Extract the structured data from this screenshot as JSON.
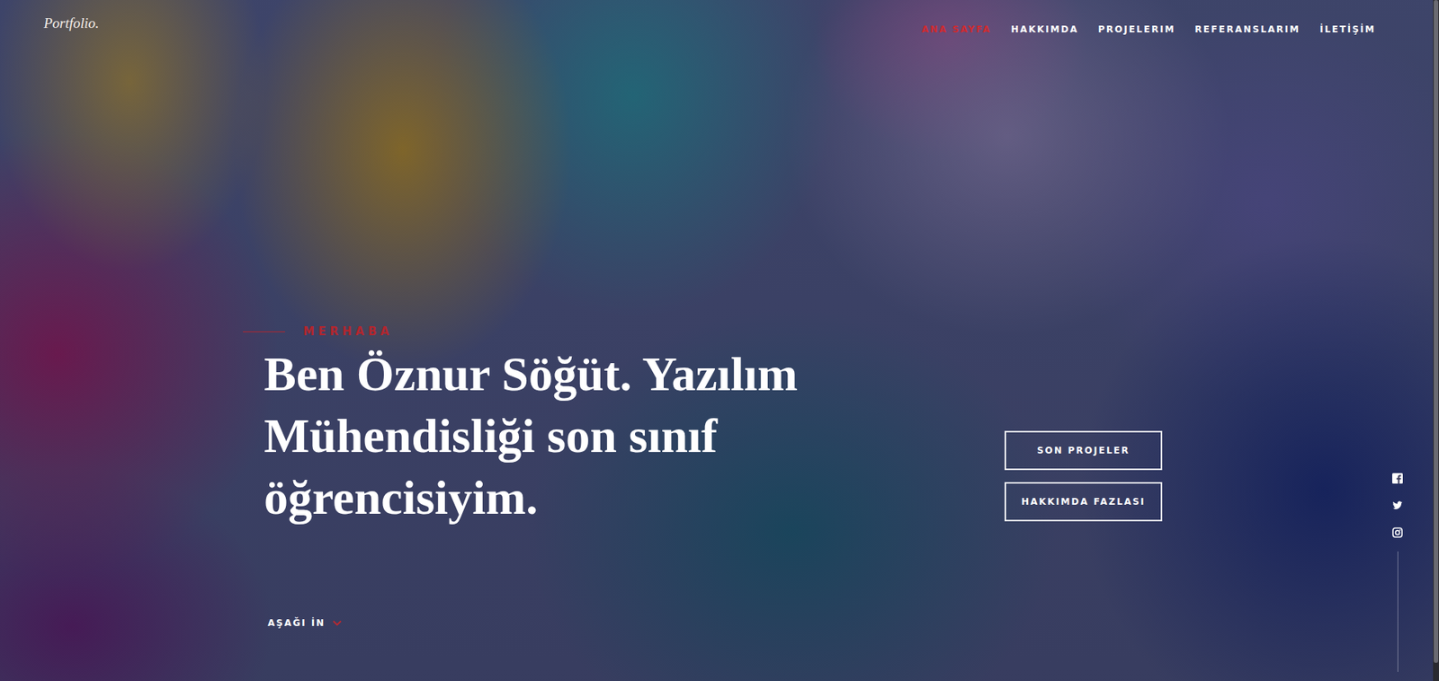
{
  "logo": "Portfolio.",
  "nav": [
    {
      "label": "ANA SAYFA",
      "selected": true
    },
    {
      "label": "HAKKIMDA",
      "selected": false
    },
    {
      "label": "PROJELERIM",
      "selected": false
    },
    {
      "label": "REFERANSLARIM",
      "selected": false
    },
    {
      "label": "İLETİŞİM",
      "selected": false
    }
  ],
  "hero": {
    "eyebrow": "MERHABA",
    "headline_lines": [
      "Ben Öznur Söğüt. Yazılım",
      "Mühendisliği son sınıf",
      "öğrencisiyim."
    ],
    "buttons": [
      "SON PROJELER",
      "HAKKIMDA FAZLASI"
    ],
    "scroll": "AŞAĞI İN"
  }
}
